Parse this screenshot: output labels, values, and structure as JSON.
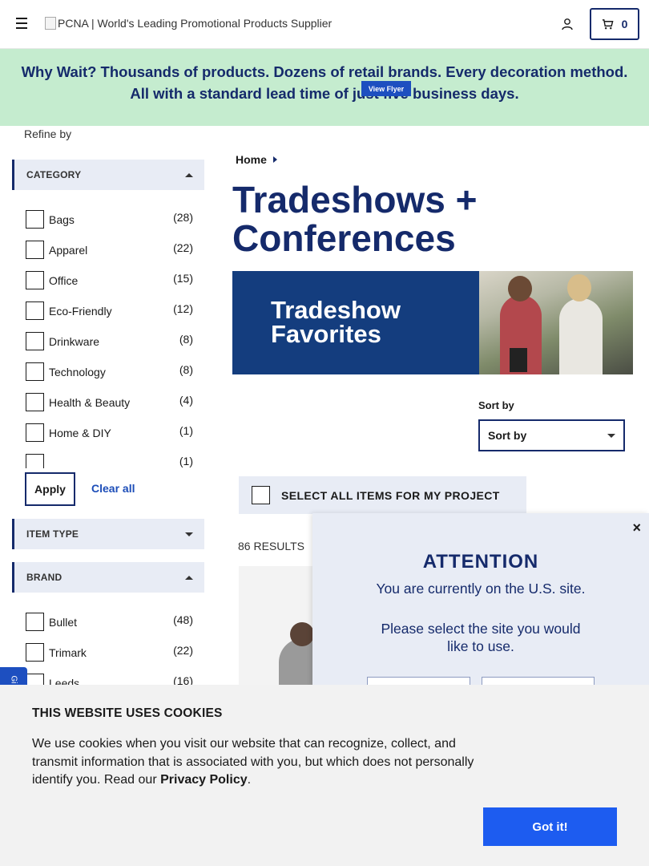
{
  "header": {
    "logo_alt": "PCNA | World's Leading Promotional Products Supplier",
    "cart_count": "0",
    "icons": {
      "menu": "hamburger-icon",
      "account": "user-icon",
      "cart": "cart-icon"
    }
  },
  "promo": {
    "text": "Why Wait? Thousands of products. Dozens of retail brands. Every decoration method. All with a standard lead time of just five business days."
  },
  "sidebar": {
    "refine_label": "Refine by",
    "category": {
      "title": "CATEGORY",
      "items": [
        {
          "label": "Bags",
          "count": "(28)"
        },
        {
          "label": "Apparel",
          "count": "(22)"
        },
        {
          "label": "Office",
          "count": "(15)"
        },
        {
          "label": "Eco-Friendly",
          "count": "(12)"
        },
        {
          "label": "Drinkware",
          "count": "(8)"
        },
        {
          "label": "Technology",
          "count": "(8)"
        },
        {
          "label": "Health & Beauty",
          "count": "(4)"
        },
        {
          "label": "Home & DIY",
          "count": "(1)"
        },
        {
          "label": "",
          "count": "(1)"
        }
      ]
    },
    "apply_label": "Apply",
    "clear_label": "Clear all",
    "item_type": {
      "title": "ITEM TYPE"
    },
    "brand": {
      "title": "BRAND",
      "items": [
        {
          "label": "Bullet",
          "count": "(48)"
        },
        {
          "label": "Trimark",
          "count": "(22)"
        },
        {
          "label": "Leeds",
          "count": "(16)"
        }
      ]
    },
    "side_tab_label": "Gi"
  },
  "main": {
    "breadcrumb": "Home",
    "title": "Tradeshows + Conferences",
    "banner": {
      "headline_line1": "Tradeshow",
      "headline_line2": "Favorites",
      "cta": "View Flyer"
    },
    "sort_label": "Sort by",
    "sort_value": "Sort by",
    "select_all": "SELECT ALL ITEMS FOR MY PROJECT",
    "results": "86 RESULTS"
  },
  "attention": {
    "title": "ATTENTION",
    "line1": "You are currently on the U.S. site.",
    "line2": "Please select the site you would like to use.",
    "close": "×"
  },
  "cookie": {
    "title": "THIS WEBSITE USES COOKIES",
    "body": "We use cookies when you visit our website that can recognize, collect, and transmit information that is associated with you, but which does not personally identify you. Read our ",
    "link": "Privacy Policy",
    "end": ".",
    "button": "Got it!"
  },
  "colors": {
    "brand_navy": "#152a6b",
    "promo_bg": "#c5eccf",
    "panel_bg": "#e8ecf5",
    "cta_blue": "#1d5cf0"
  }
}
